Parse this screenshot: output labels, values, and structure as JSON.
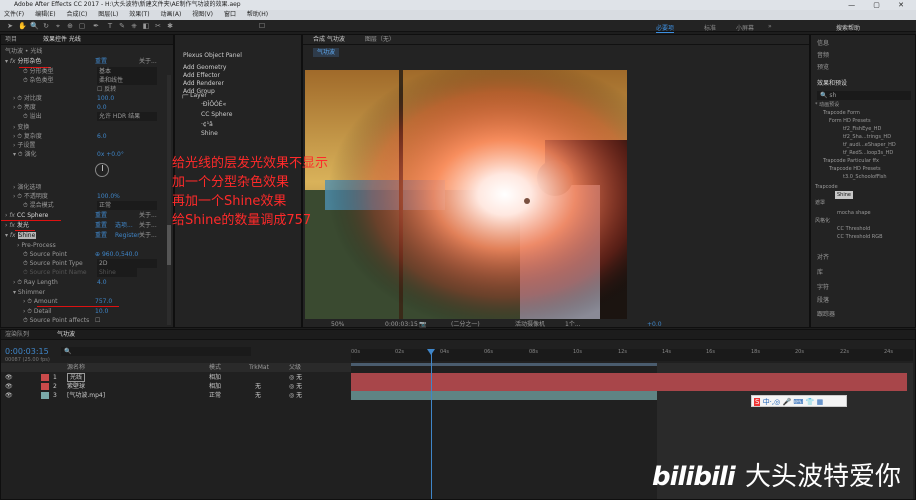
{
  "app": {
    "title": "Adobe After Effects CC 2017 - H:\\大头波特\\新建文件夹\\AE制作气功波的效果.aep",
    "window_controls": "—  ▢  ✕"
  },
  "menu": [
    "文件(F)",
    "编辑(E)",
    "合成(C)",
    "图层(L)",
    "效果(T)",
    "动画(A)",
    "视图(V)",
    "窗口",
    "帮助(H)"
  ],
  "workspaces": {
    "default": "必要项",
    "standard": "标准",
    "small": "小屏幕",
    "search": "搜索帮助"
  },
  "left_panel": {
    "tabs": [
      "项目",
      "效果控件 光线"
    ],
    "breadcrumb": "气功波 • 光线",
    "effects": [
      {
        "name": "分形杂色",
        "reset": "重置",
        "about": "关于..."
      },
      {
        "name": "CC Sphere",
        "reset": "重置",
        "about": "关于..."
      },
      {
        "name": "发光",
        "reset": "重置",
        "extra": "选项...",
        "about": "关于..."
      },
      {
        "name": "Shine",
        "reset": "重置",
        "extra": "Register",
        "about": "关于..."
      }
    ],
    "fractal": [
      {
        "label": "分形类型",
        "value": "基本"
      },
      {
        "label": "杂色类型",
        "value": "柔和线性"
      },
      {
        "label": "",
        "value": "反转"
      },
      {
        "label": "对比度",
        "value": "100.0"
      },
      {
        "label": "亮度",
        "value": "0.0"
      },
      {
        "label": "溢出",
        "value": "允许 HDR 结果"
      },
      {
        "label": "变换",
        "value": ""
      },
      {
        "label": "复杂度",
        "value": "6.0"
      },
      {
        "label": "子设置",
        "value": ""
      },
      {
        "label": "演化",
        "value": "0x +0.0°"
      },
      {
        "label": "演化选项",
        "value": ""
      },
      {
        "label": "不透明度",
        "value": "100.0%"
      },
      {
        "label": "混合模式",
        "value": "正常"
      }
    ],
    "shine": [
      {
        "label": "Pre-Process",
        "value": ""
      },
      {
        "label": "Source Point",
        "value": "960.0,540.0"
      },
      {
        "label": "Source Point Type",
        "value": "2D"
      },
      {
        "label": "Source Point Name",
        "value": "Shine"
      },
      {
        "label": "Ray Length",
        "value": "4.0"
      },
      {
        "label": "Shimmer",
        "value": ""
      },
      {
        "label": "Amount",
        "value": "757.0"
      },
      {
        "label": "Detail",
        "value": "10.0"
      },
      {
        "label": "Source Point affects",
        "value": ""
      }
    ]
  },
  "plexus": {
    "title": "Plexus Object Panel",
    "buttons": [
      "Add Geometry",
      "Add Effector",
      "Add Renderer",
      "Add Group"
    ],
    "tree_root": "Layer",
    "tree_items": [
      "·ÐÎÔÓÉ«",
      "CC Sphere",
      "·¢¹â",
      "Shine"
    ]
  },
  "viewer": {
    "tab_comp": "合成 气功波",
    "tab_layer": "图层（无）",
    "subtab": "气功波",
    "zoom": "50%",
    "timecode": "0:00:03:15",
    "quality": "(二分之一)",
    "camera": "活动摄像机",
    "views": "1个...",
    "exposure": "+0.0"
  },
  "annotation": [
    "给光线的层发光效果不显示",
    "加一个分型杂色效果",
    "再加一个Shine效果",
    "给Shine的数量调成757"
  ],
  "right_panel": {
    "items": [
      "信息",
      "音频",
      "预览",
      "效果和预设"
    ],
    "search": "sh",
    "tree": [
      "* 动画预设",
      "Trapcode Form",
      "Form HD Presets",
      "tf2_FishEye_HD",
      "tf2_Sha...trings_HD",
      "tf_audi...eShaper_HD",
      "tf_RedS...loop3s_HD",
      "Trapcode Particular ffx",
      "Trapcode HD Presets",
      "t3.0_SchoolofFish",
      "Trapcode",
      "Shine",
      "遮罩",
      "mocha shape",
      "风格化",
      "CC Threshold",
      "CC Threshold RGB"
    ],
    "bottom_items": [
      "对齐",
      "库",
      "字符",
      "段落",
      "跟踪器",
      "画笔"
    ]
  },
  "timeline": {
    "tabs": [
      "渲染队列",
      "气功波"
    ],
    "timecode": "0:00:03:15",
    "fps": "00087 (25.00 fps)",
    "columns": {
      "source": "源名称",
      "mode": "模式",
      "trkmat": "TrkMat",
      "parent": "父级"
    },
    "layers": [
      {
        "num": "1",
        "name": "光线",
        "mode": "相加",
        "trk": "",
        "parent": "无"
      },
      {
        "num": "2",
        "name": "紫壁球",
        "mode": "相加",
        "trk": "无",
        "parent": "无"
      },
      {
        "num": "3",
        "name": "[气功波.mp4]",
        "mode": "正常",
        "trk": "无",
        "parent": "无"
      }
    ],
    "ruler": [
      "00s",
      "02s",
      "04s",
      "06s",
      "08s",
      "10s",
      "12s",
      "14s",
      "16s",
      "18s",
      "20s",
      "22s",
      "24s"
    ]
  },
  "watermark": "大头波特爱你",
  "ime": "中·,◎ 🎤 ⌨ 👕 ▦"
}
